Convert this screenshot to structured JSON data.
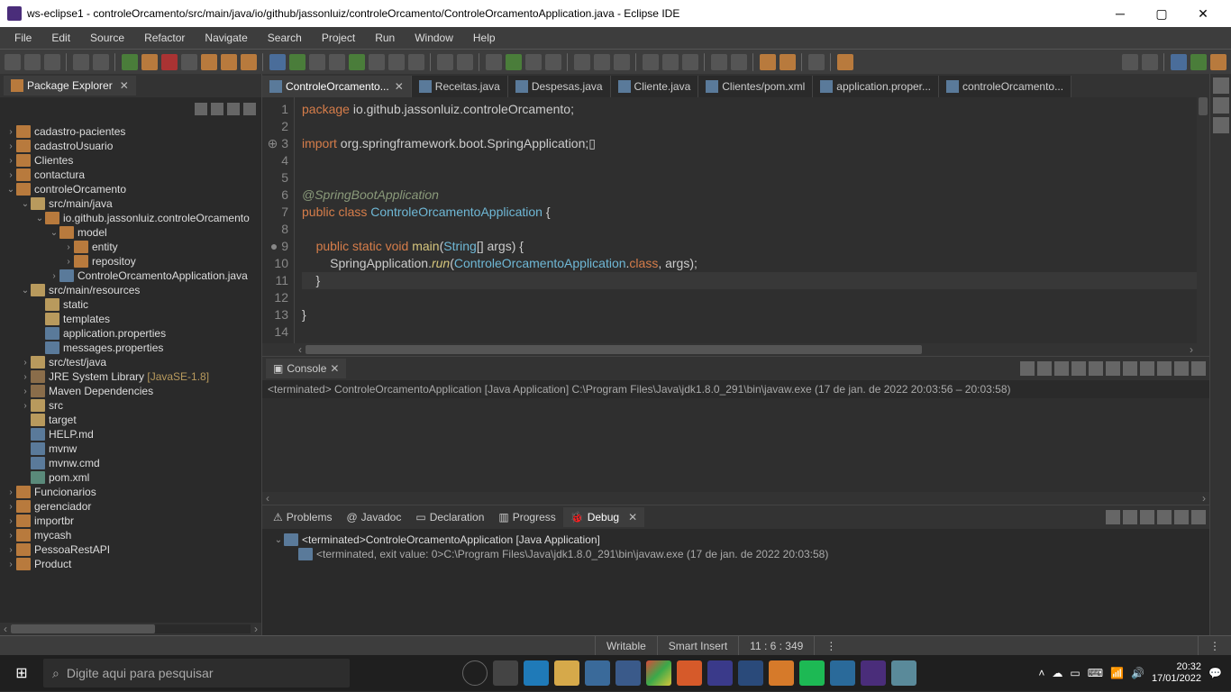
{
  "titlebar": {
    "title": "ws-eclipse1 - controleOrcamento/src/main/java/io/github/jassonluiz/controleOrcamento/ControleOrcamentoApplication.java - Eclipse IDE"
  },
  "menu": {
    "items": [
      "File",
      "Edit",
      "Source",
      "Refactor",
      "Navigate",
      "Search",
      "Project",
      "Run",
      "Window",
      "Help"
    ]
  },
  "packageExplorer": {
    "title": "Package Explorer",
    "items": [
      {
        "lvl": 0,
        "caret": "›",
        "icon": "pkg",
        "label": "cadastro-pacientes"
      },
      {
        "lvl": 0,
        "caret": "›",
        "icon": "pkg",
        "label": "cadastroUsuario"
      },
      {
        "lvl": 0,
        "caret": "›",
        "icon": "pkg",
        "label": "Clientes"
      },
      {
        "lvl": 0,
        "caret": "›",
        "icon": "pkg",
        "label": "contactura"
      },
      {
        "lvl": 0,
        "caret": "⌄",
        "icon": "pkg",
        "label": "controleOrcamento"
      },
      {
        "lvl": 1,
        "caret": "⌄",
        "icon": "folder",
        "label": "src/main/java"
      },
      {
        "lvl": 2,
        "caret": "⌄",
        "icon": "pkg",
        "label": "io.github.jassonluiz.controleOrcamento"
      },
      {
        "lvl": 3,
        "caret": "⌄",
        "icon": "pkg",
        "label": "model"
      },
      {
        "lvl": 4,
        "caret": "›",
        "icon": "pkg",
        "label": "entity"
      },
      {
        "lvl": 4,
        "caret": "›",
        "icon": "pkg",
        "label": "repositoy"
      },
      {
        "lvl": 3,
        "caret": "›",
        "icon": "file",
        "label": "ControleOrcamentoApplication.java"
      },
      {
        "lvl": 1,
        "caret": "⌄",
        "icon": "folder",
        "label": "src/main/resources"
      },
      {
        "lvl": 2,
        "caret": "",
        "icon": "folder",
        "label": "static"
      },
      {
        "lvl": 2,
        "caret": "",
        "icon": "folder",
        "label": "templates"
      },
      {
        "lvl": 2,
        "caret": "",
        "icon": "file",
        "label": "application.properties"
      },
      {
        "lvl": 2,
        "caret": "",
        "icon": "file",
        "label": "messages.properties"
      },
      {
        "lvl": 1,
        "caret": "›",
        "icon": "folder",
        "label": "src/test/java"
      },
      {
        "lvl": 1,
        "caret": "›",
        "icon": "jar",
        "label": "JRE System Library ",
        "extra": "[JavaSE-1.8]"
      },
      {
        "lvl": 1,
        "caret": "›",
        "icon": "jar",
        "label": "Maven Dependencies"
      },
      {
        "lvl": 1,
        "caret": "›",
        "icon": "folder",
        "label": "src"
      },
      {
        "lvl": 1,
        "caret": "",
        "icon": "folder",
        "label": "target"
      },
      {
        "lvl": 1,
        "caret": "",
        "icon": "file",
        "label": "HELP.md"
      },
      {
        "lvl": 1,
        "caret": "",
        "icon": "file",
        "label": "mvnw"
      },
      {
        "lvl": 1,
        "caret": "",
        "icon": "file",
        "label": "mvnw.cmd"
      },
      {
        "lvl": 1,
        "caret": "",
        "icon": "xml",
        "label": "pom.xml"
      },
      {
        "lvl": 0,
        "caret": "›",
        "icon": "pkg",
        "label": "Funcionarios"
      },
      {
        "lvl": 0,
        "caret": "›",
        "icon": "pkg",
        "label": "gerenciador"
      },
      {
        "lvl": 0,
        "caret": "›",
        "icon": "pkg",
        "label": "importbr"
      },
      {
        "lvl": 0,
        "caret": "›",
        "icon": "pkg",
        "label": "mycash"
      },
      {
        "lvl": 0,
        "caret": "›",
        "icon": "pkg",
        "label": "PessoaRestAPI"
      },
      {
        "lvl": 0,
        "caret": "›",
        "icon": "pkg",
        "label": "Product"
      }
    ]
  },
  "editorTabs": [
    {
      "label": "ControleOrcamento...",
      "active": true,
      "close": true
    },
    {
      "label": "Receitas.java",
      "active": false
    },
    {
      "label": "Despesas.java",
      "active": false
    },
    {
      "label": "Cliente.java",
      "active": false
    },
    {
      "label": "Clientes/pom.xml",
      "active": false
    },
    {
      "label": "application.proper...",
      "active": false
    },
    {
      "label": "controleOrcamento...",
      "active": false
    }
  ],
  "code": {
    "lines": [
      "1",
      "2",
      "3",
      "4",
      "5",
      "6",
      "7",
      "8",
      "9",
      "10",
      "11",
      "12",
      "13",
      "14"
    ]
  },
  "console": {
    "title": "Console",
    "header": "<terminated>  ControleOrcamentoApplication [Java Application] C:\\Program Files\\Java\\jdk1.8.0_291\\bin\\javaw.exe  (17 de jan. de 2022 20:03:56 – 20:03:58)"
  },
  "bottomTabs": {
    "tabs": [
      "Problems",
      "Javadoc",
      "Declaration",
      "Progress",
      "Debug"
    ],
    "active": 4,
    "debugTree": {
      "root": "<terminated>ControleOrcamentoApplication [Java Application]",
      "child": "<terminated, exit value: 0>C:\\Program Files\\Java\\jdk1.8.0_291\\bin\\javaw.exe (17 de jan. de 2022 20:03:58)"
    }
  },
  "status": {
    "writable": "Writable",
    "insert": "Smart Insert",
    "pos": "11 : 6 : 349"
  },
  "taskbar": {
    "search": "Digite aqui para pesquisar",
    "time": "20:32",
    "date": "17/01/2022"
  }
}
